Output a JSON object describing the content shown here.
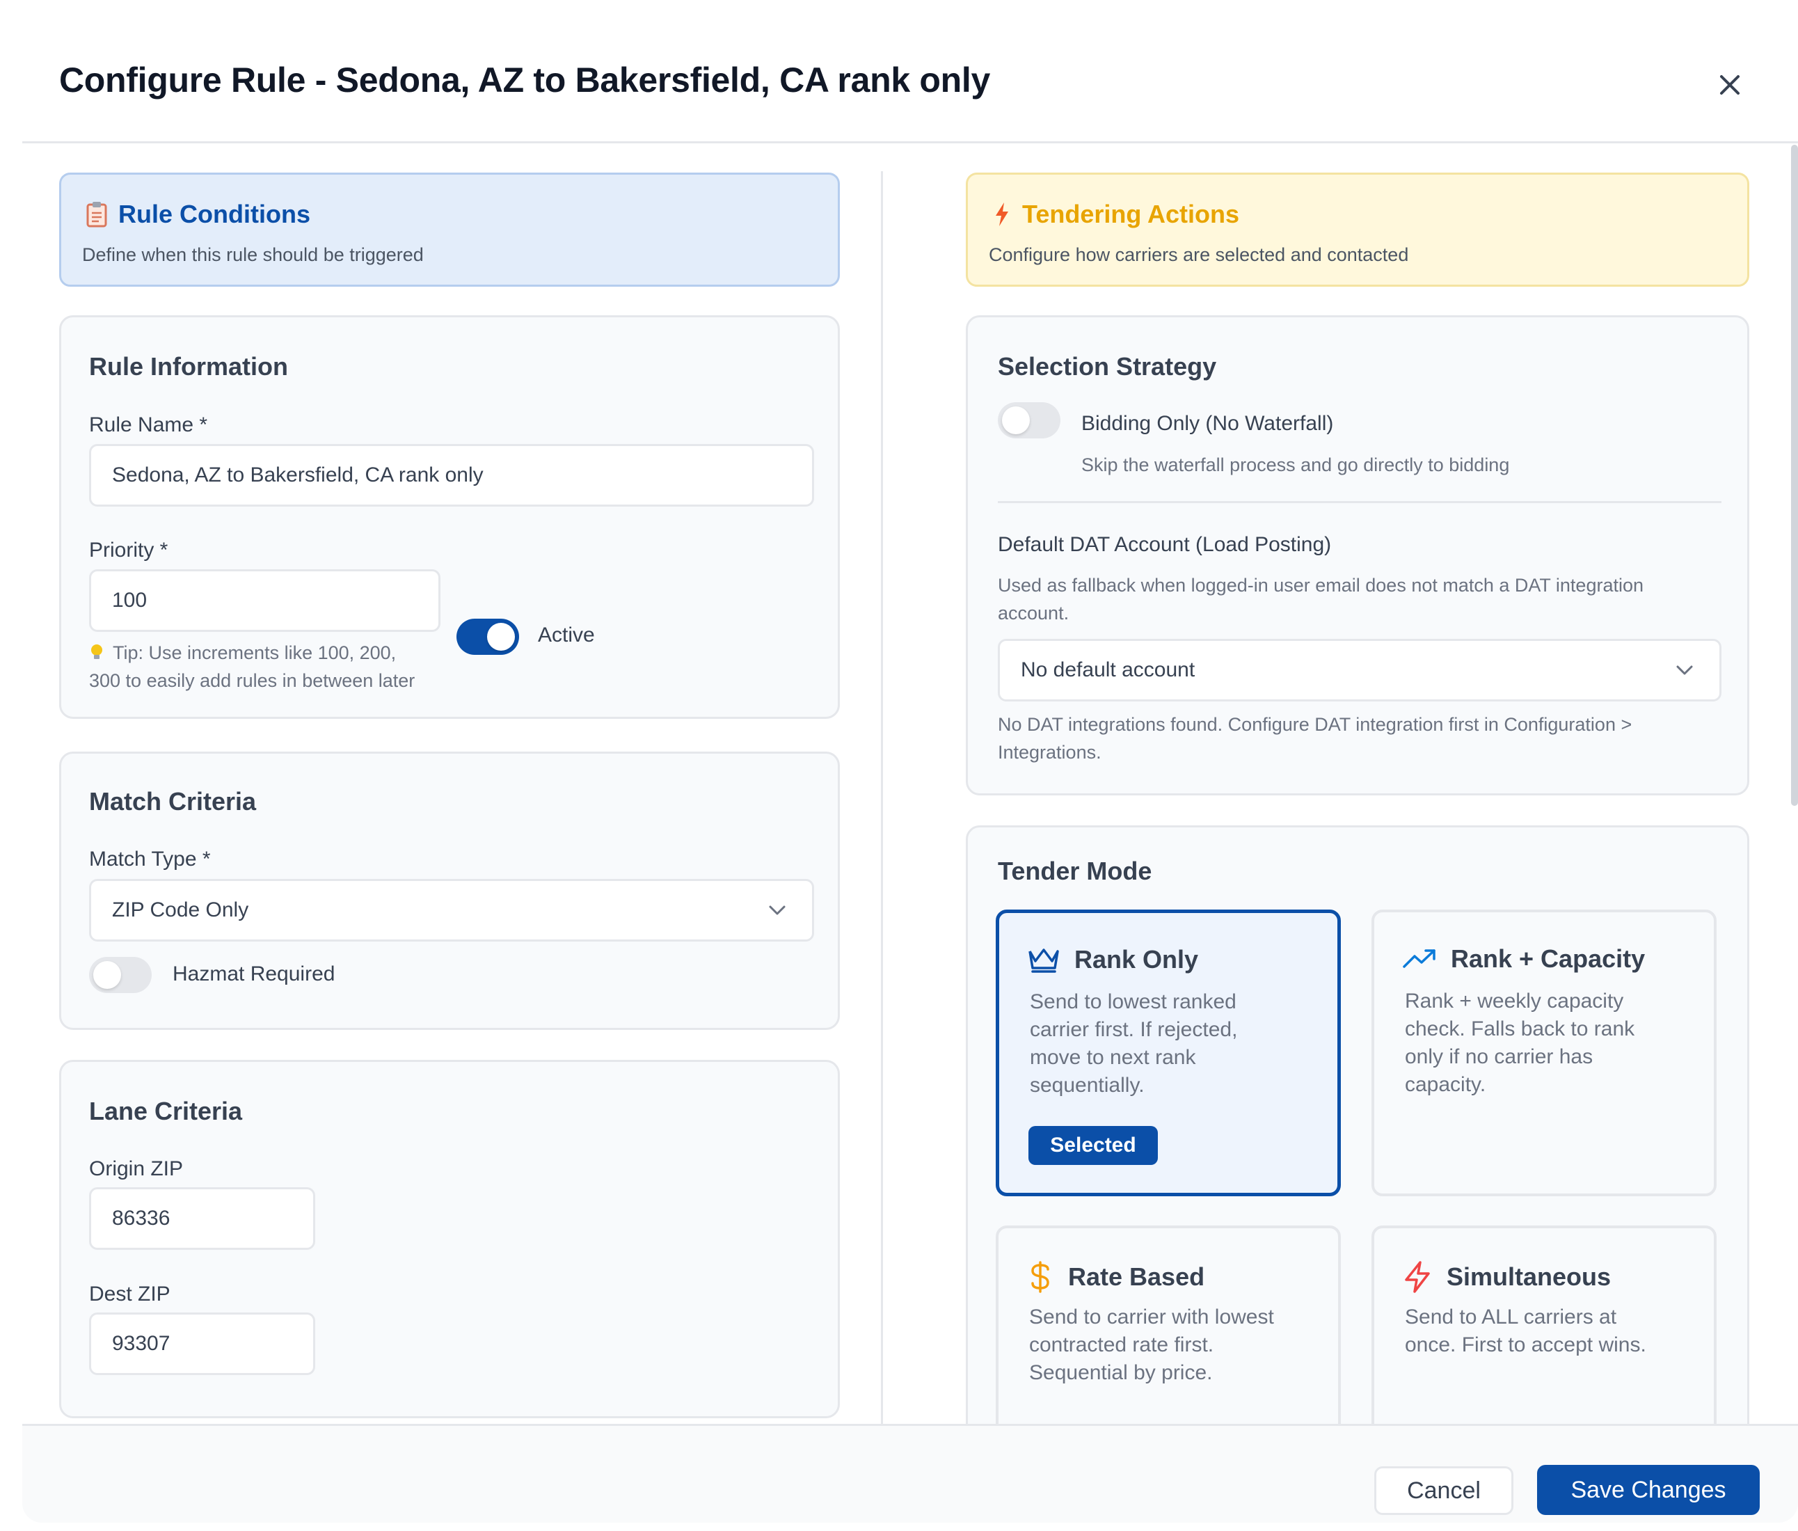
{
  "modal": {
    "title": "Configure Rule - Sedona, AZ to Bakersfield, CA rank only"
  },
  "conditions_banner": {
    "title": "Rule Conditions",
    "subtitle": "Define when this rule should be triggered"
  },
  "actions_banner": {
    "title": "Tendering Actions",
    "subtitle": "Configure how carriers are selected and contacted"
  },
  "rule_information": {
    "title": "Rule Information",
    "rule_name_label": "Rule Name *",
    "rule_name_value": "Sedona, AZ to Bakersfield, CA rank only",
    "priority_label": "Priority *",
    "priority_value": "100",
    "tip_line1": "Tip: Use increments like 100, 200,",
    "tip_line2": "300 to easily add rules in between later",
    "active_label": "Active",
    "active": true
  },
  "match_criteria": {
    "title": "Match Criteria",
    "match_type_label": "Match Type *",
    "match_type_value": "ZIP Code Only",
    "hazmat_label": "Hazmat Required",
    "hazmat": false
  },
  "lane_criteria": {
    "title": "Lane Criteria",
    "origin_zip_label": "Origin ZIP",
    "origin_zip_value": "86336",
    "dest_zip_label": "Dest ZIP",
    "dest_zip_value": "93307"
  },
  "selection_strategy": {
    "title": "Selection Strategy",
    "bidding_only_label": "Bidding Only (No Waterfall)",
    "bidding_only_hint": "Skip the waterfall process and go directly to bidding",
    "bidding_only": false,
    "dat_account_label": "Default DAT Account (Load Posting)",
    "dat_account_hint_line1": "Used as fallback when logged-in user email does not match a DAT integration",
    "dat_account_hint_line2": "account.",
    "dat_account_value": "No default account",
    "dat_warning_line1": "No DAT integrations found. Configure DAT integration first in Configuration >",
    "dat_warning_line2": "Integrations."
  },
  "tender_mode": {
    "title": "Tender Mode",
    "selected_label": "Selected",
    "options": [
      {
        "name": "Rank Only",
        "icon": "crown-icon",
        "desc": [
          "Send to lowest ranked",
          "carrier first. If rejected,",
          "move to next rank",
          "sequentially."
        ],
        "selected": true
      },
      {
        "name": "Rank + Capacity",
        "icon": "trending-up-icon",
        "desc": [
          "Rank + weekly capacity",
          "check. Falls back to rank",
          "only if no carrier has",
          "capacity."
        ],
        "selected": false
      },
      {
        "name": "Rate Based",
        "icon": "dollar-icon",
        "desc": [
          "Send to carrier with lowest",
          "contracted rate first.",
          "Sequential by price."
        ],
        "selected": false
      },
      {
        "name": "Simultaneous",
        "icon": "lightning-icon",
        "desc": [
          "Send to ALL carriers at",
          "once. First to accept wins."
        ],
        "selected": false
      }
    ]
  },
  "footer": {
    "cancel_label": "Cancel",
    "save_label": "Save Changes"
  },
  "colors": {
    "primary": "#0b4fa8",
    "warning": "#e8a400",
    "simultaneous_icon": "#ef4444",
    "rate_icon": "#f59e0b"
  }
}
